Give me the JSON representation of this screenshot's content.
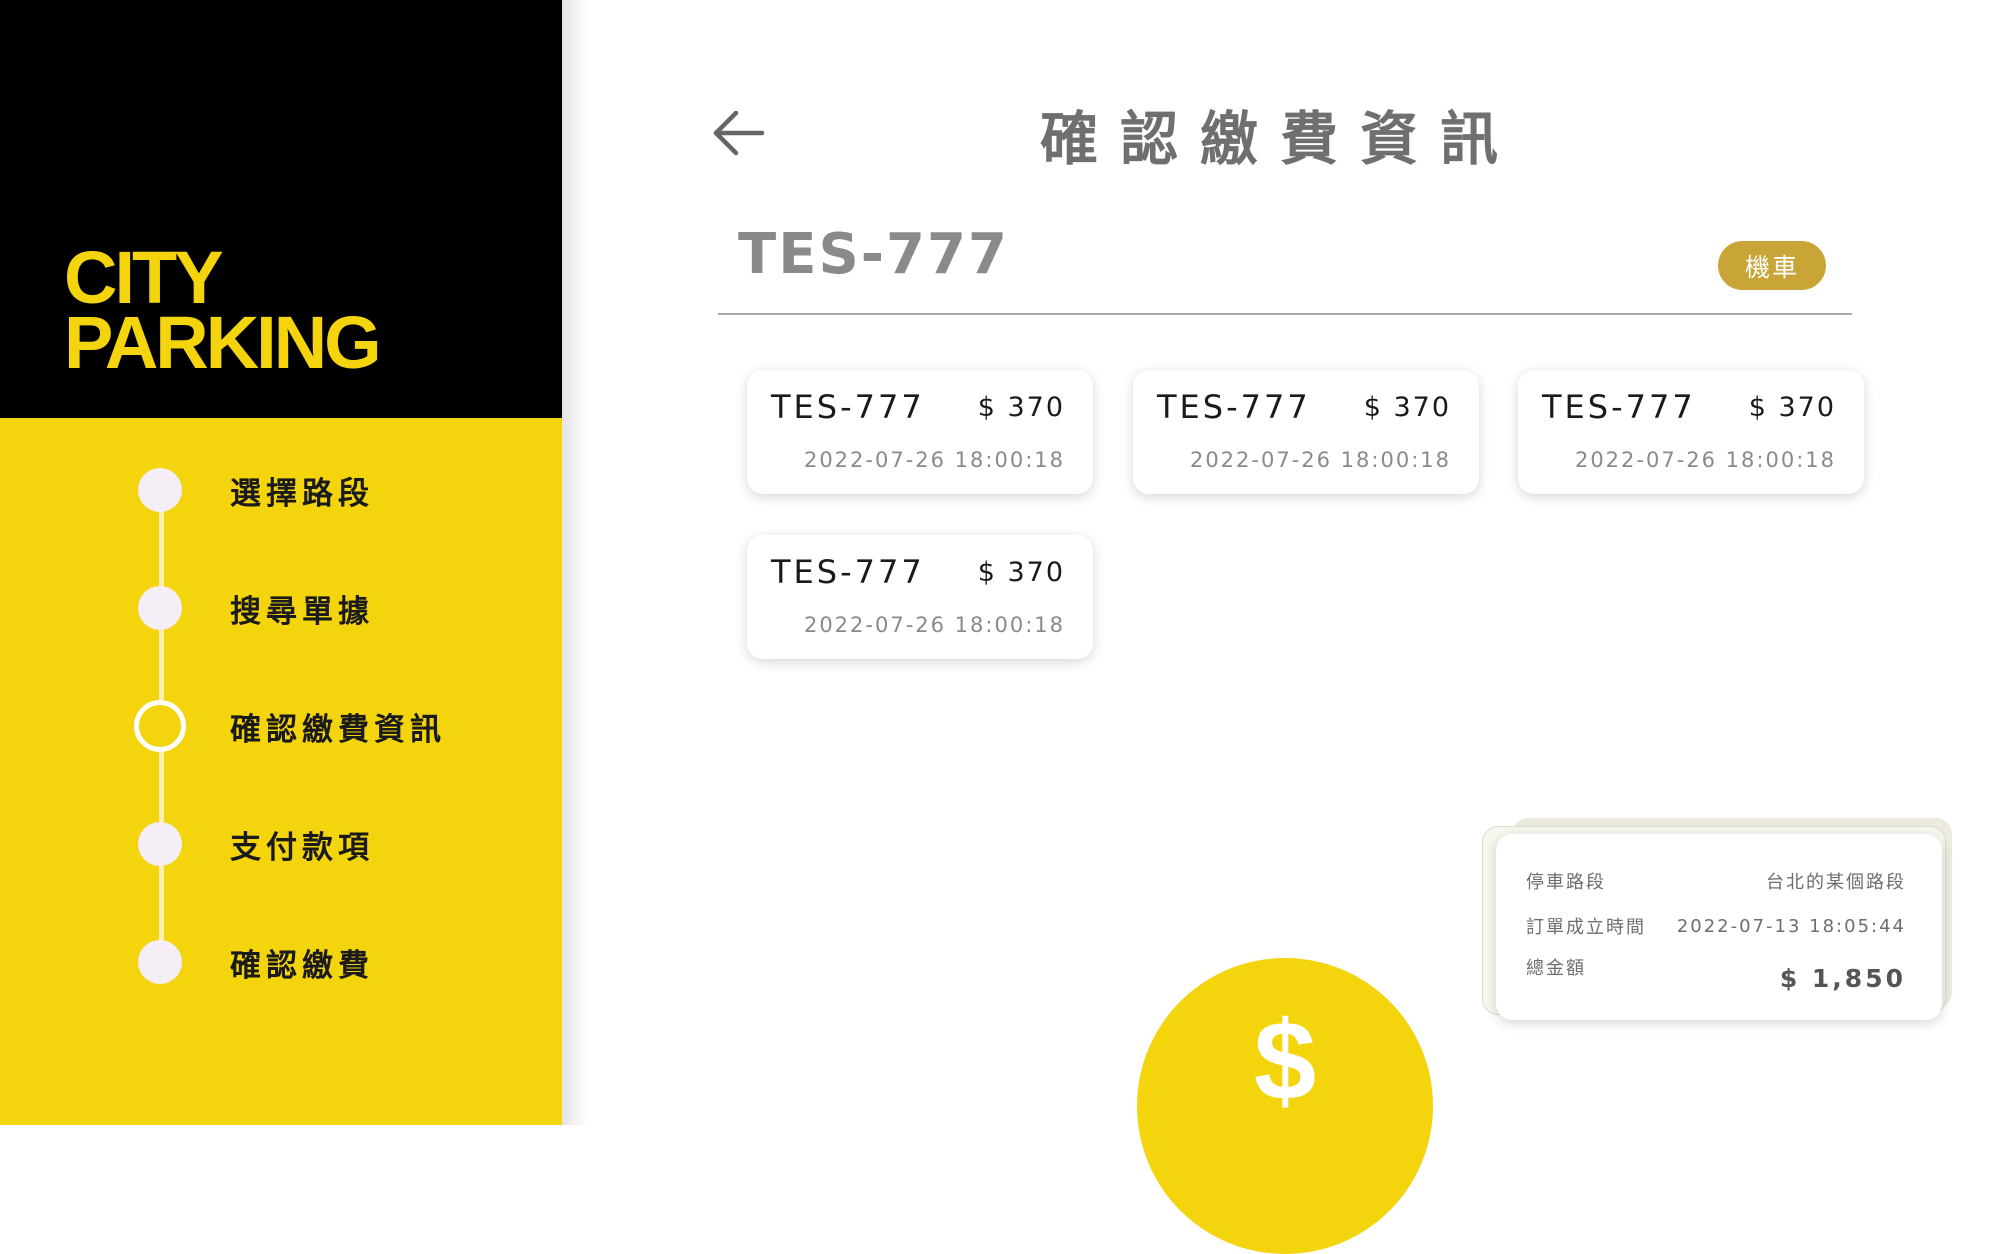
{
  "brand": {
    "line1": "CITY",
    "line2": "PARKING"
  },
  "steps": [
    {
      "label": "選擇路段",
      "active": false
    },
    {
      "label": "搜尋單據",
      "active": false
    },
    {
      "label": "確認繳費資訊",
      "active": true
    },
    {
      "label": "支付款項",
      "active": false
    },
    {
      "label": "確認繳費",
      "active": false
    }
  ],
  "header": {
    "title": "確認繳費資訊",
    "back_icon": "arrow-left-icon"
  },
  "vehicle": {
    "plate": "TES-777",
    "type_badge": "機車"
  },
  "tickets": [
    {
      "plate": "TES-777",
      "amount": "$ 370",
      "datetime": "2022-07-26 18:00:18"
    },
    {
      "plate": "TES-777",
      "amount": "$ 370",
      "datetime": "2022-07-26 18:00:18"
    },
    {
      "plate": "TES-777",
      "amount": "$ 370",
      "datetime": "2022-07-26 18:00:18"
    },
    {
      "plate": "TES-777",
      "amount": "$ 370",
      "datetime": "2022-07-26 18:00:18"
    }
  ],
  "summary": {
    "road_label": "停車路段",
    "road_value": "台北的某個路段",
    "time_label": "訂單成立時間",
    "time_value": "2022-07-13 18:05:44",
    "total_label": "總金額",
    "total_value": "$ 1,850"
  },
  "pay_button": {
    "symbol": "$",
    "icon": "dollar-icon"
  },
  "colors": {
    "brand_yellow": "#f4d40c",
    "badge_gold": "#c8a536",
    "sidebar_black": "#000000"
  }
}
